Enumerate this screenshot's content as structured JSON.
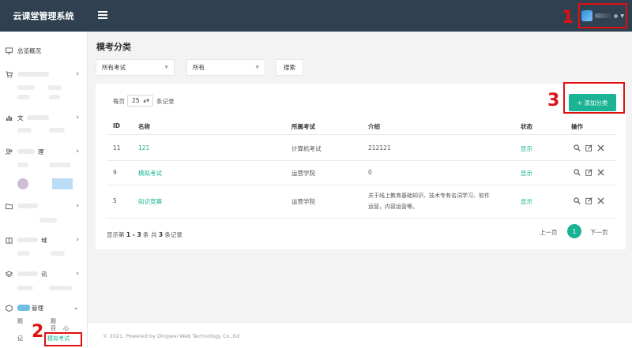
{
  "app": {
    "title": "云课堂管理系统"
  },
  "sidebar": {
    "items": [
      {
        "label": "总览概况",
        "icon": "monitor-icon"
      },
      {
        "label": "",
        "icon": "cart-icon"
      },
      {
        "label": "文",
        "icon": "bar-chart-icon"
      },
      {
        "label": "理",
        "icon": "users-icon"
      },
      {
        "label": "",
        "icon": "folder-icon"
      },
      {
        "label": "域",
        "icon": "building-icon"
      },
      {
        "label": "讯",
        "icon": "layers-icon"
      },
      {
        "label": "管理",
        "icon": "box-icon"
      }
    ],
    "sub_labels": [
      "题",
      "题",
      "记",
      "目",
      "心"
    ],
    "active_sub": "模拟考试"
  },
  "main": {
    "title": "模考分类",
    "filters": {
      "exam_select": "所有考试",
      "status_select": "所有",
      "search_label": "搜索"
    },
    "page_size": {
      "prefix": "每页",
      "value": "25",
      "suffix": "条记录"
    },
    "add_button": "+ 添加分类",
    "table": {
      "headers": [
        "ID",
        "名称",
        "所属考试",
        "介绍",
        "状态",
        "操作"
      ],
      "rows": [
        {
          "id": "11",
          "name": "121",
          "exam": "计算机考试",
          "intro_1": "212121",
          "intro_2": "",
          "status": "显示"
        },
        {
          "id": "9",
          "name": "模拟考试",
          "exam": "运营学院",
          "intro_1": "0",
          "intro_2": "",
          "status": "显示"
        },
        {
          "id": "5",
          "name": "知识竞赛",
          "exam": "运营学院",
          "intro_1": "关于线上教育基础知识、技术专有名词学习、软件",
          "intro_2": "运营，内容运营等。",
          "status": "显示"
        }
      ]
    },
    "summary": {
      "prefix": "显示第 ",
      "range": "1 - 3",
      "middle": " 条   共 ",
      "total": "3",
      "suffix": " 条记录"
    },
    "pagination": {
      "prev": "上一页",
      "current": "1",
      "next": "下一页"
    }
  },
  "footer": {
    "text": "© 2021. Powered by Dingwei Web Technology Co.,ltd"
  },
  "annotations": [
    "1",
    "2",
    "3"
  ],
  "colors": {
    "accent": "#1ab394",
    "topbar": "#2f4050",
    "annotation": "#e01010"
  }
}
